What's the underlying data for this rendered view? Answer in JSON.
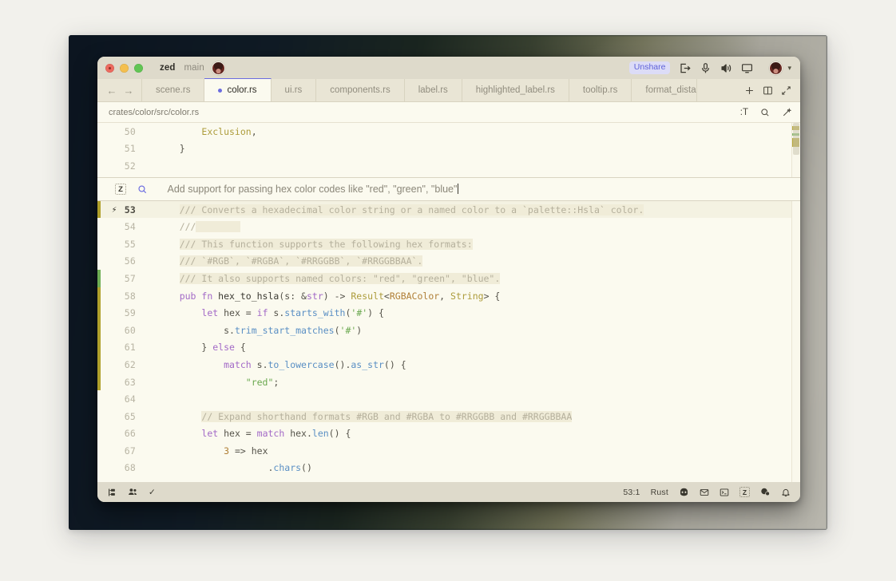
{
  "window": {
    "project": "zed",
    "branch": "main",
    "unshare_label": "Unshare"
  },
  "titlebar_icons": [
    {
      "name": "leave-call-icon"
    },
    {
      "name": "microphone-icon"
    },
    {
      "name": "speaker-icon"
    },
    {
      "name": "screen-share-icon"
    }
  ],
  "nav": {
    "back": "←",
    "forward": "→"
  },
  "tabs": [
    {
      "label": "scene.rs",
      "active": false
    },
    {
      "label": "color.rs",
      "active": true
    },
    {
      "label": "ui.rs",
      "active": false
    },
    {
      "label": "components.rs",
      "active": false
    },
    {
      "label": "label.rs",
      "active": false
    },
    {
      "label": "highlighted_label.rs",
      "active": false
    },
    {
      "label": "tooltip.rs",
      "active": false
    },
    {
      "label": "format_dista",
      "active": false
    }
  ],
  "tab_actions": [
    {
      "name": "new-tab-button",
      "glyph": "+"
    },
    {
      "name": "split-pane-button",
      "glyph": "split"
    },
    {
      "name": "zoom-pane-button",
      "glyph": "expand"
    }
  ],
  "breadcrumb": {
    "path": "crates/color/src/color.rs",
    "actions": [
      {
        "name": "toggle-inlay-hints-button",
        "label": ":T"
      },
      {
        "name": "buffer-search-button",
        "label": "search"
      },
      {
        "name": "selection-tools-button",
        "label": "wand"
      }
    ]
  },
  "assist": {
    "prompt": "Add support for passing hex color codes like \"red\", \"green\", \"blue\"",
    "zed_icon": "Z",
    "search_icon": "search-icon"
  },
  "editor": {
    "lines_above": [
      {
        "num": "50",
        "indent": 8,
        "segments": [
          {
            "t": "Exclusion",
            "c": "c-ty"
          },
          {
            "t": ",",
            "c": "c-punc"
          }
        ]
      },
      {
        "num": "51",
        "indent": 4,
        "segments": [
          {
            "t": "}",
            "c": "c-punc"
          }
        ]
      },
      {
        "num": "52",
        "indent": 0,
        "segments": []
      }
    ],
    "lines_below": [
      {
        "num": "53",
        "current": true,
        "bolt": "⚡",
        "git": "mod",
        "indent": 4,
        "segments": [
          {
            "t": "/// Converts a hexadecimal color string or a named color to a `palette::Hsla` color.",
            "c": "c-com hl"
          }
        ]
      },
      {
        "num": "54",
        "indent": 4,
        "segments": [
          {
            "t": "///",
            "c": "c-com"
          },
          {
            "t": "        ",
            "c": "hl"
          }
        ]
      },
      {
        "num": "55",
        "indent": 4,
        "segments": [
          {
            "t": "/// This function supports the following hex formats:",
            "c": "c-com hl"
          }
        ]
      },
      {
        "num": "56",
        "indent": 4,
        "segments": [
          {
            "t": "/// `#RGB`, `#RGBA`, `#RRGGBB`, `#RRGGBBAA`.",
            "c": "c-com hl"
          }
        ]
      },
      {
        "num": "57",
        "git": "add",
        "indent": 4,
        "segments": [
          {
            "t": "/// It also supports named colors: \"red\", \"green\", \"blue\".",
            "c": "c-com hl"
          }
        ]
      },
      {
        "num": "58",
        "git": "mod",
        "indent": 4,
        "segments": [
          {
            "t": "pub fn ",
            "c": "c-kw"
          },
          {
            "t": "hex_to_hsla",
            "c": "c-fn"
          },
          {
            "t": "(s: &",
            "c": "c-punc"
          },
          {
            "t": "str",
            "c": "c-kw"
          },
          {
            "t": ") -> ",
            "c": "c-punc"
          },
          {
            "t": "Result",
            "c": "c-ty"
          },
          {
            "t": "<",
            "c": "c-punc"
          },
          {
            "t": "RGBAColor",
            "c": "c-type2"
          },
          {
            "t": ", ",
            "c": "c-punc"
          },
          {
            "t": "String",
            "c": "c-ty"
          },
          {
            "t": "> {",
            "c": "c-punc"
          }
        ]
      },
      {
        "num": "59",
        "git": "mod",
        "indent": 8,
        "segments": [
          {
            "t": "let",
            "c": "c-kw"
          },
          {
            "t": " hex = ",
            "c": "c-punc"
          },
          {
            "t": "if",
            "c": "c-kw"
          },
          {
            "t": " s.",
            "c": "c-punc"
          },
          {
            "t": "starts_with",
            "c": "c-meth"
          },
          {
            "t": "(",
            "c": "c-punc"
          },
          {
            "t": "'#'",
            "c": "c-str"
          },
          {
            "t": ") {",
            "c": "c-punc"
          }
        ]
      },
      {
        "num": "60",
        "git": "mod",
        "indent": 12,
        "segments": [
          {
            "t": "s.",
            "c": "c-punc"
          },
          {
            "t": "trim_start_matches",
            "c": "c-meth"
          },
          {
            "t": "(",
            "c": "c-punc"
          },
          {
            "t": "'#'",
            "c": "c-str"
          },
          {
            "t": ")",
            "c": "c-punc"
          }
        ]
      },
      {
        "num": "61",
        "git": "mod",
        "indent": 8,
        "segments": [
          {
            "t": "} ",
            "c": "c-punc"
          },
          {
            "t": "else",
            "c": "c-kw"
          },
          {
            "t": " {",
            "c": "c-punc"
          }
        ]
      },
      {
        "num": "62",
        "git": "mod",
        "indent": 12,
        "segments": [
          {
            "t": "match",
            "c": "c-kw"
          },
          {
            "t": " s.",
            "c": "c-punc"
          },
          {
            "t": "to_lowercase",
            "c": "c-meth"
          },
          {
            "t": "().",
            "c": "c-punc"
          },
          {
            "t": "as_str",
            "c": "c-meth"
          },
          {
            "t": "() {",
            "c": "c-punc"
          }
        ]
      },
      {
        "num": "63",
        "git": "mod",
        "indent": 16,
        "segments": [
          {
            "t": "\"red\"",
            "c": "c-str"
          },
          {
            "t": ";",
            "c": "c-punc"
          }
        ]
      },
      {
        "num": "64",
        "indent": 0,
        "segments": []
      },
      {
        "num": "65",
        "indent": 8,
        "segments": [
          {
            "t": "// Expand shorthand formats #RGB and #RGBA to #RRGGBB and #RRGGBBAA",
            "c": "c-com hl"
          }
        ]
      },
      {
        "num": "66",
        "indent": 8,
        "segments": [
          {
            "t": "let",
            "c": "c-kw"
          },
          {
            "t": " hex = ",
            "c": "c-punc"
          },
          {
            "t": "match",
            "c": "c-kw"
          },
          {
            "t": " hex.",
            "c": "c-punc"
          },
          {
            "t": "len",
            "c": "c-meth"
          },
          {
            "t": "() {",
            "c": "c-punc"
          }
        ]
      },
      {
        "num": "67",
        "indent": 12,
        "segments": [
          {
            "t": "3",
            "c": "c-num"
          },
          {
            "t": " => hex",
            "c": "c-punc"
          }
        ]
      },
      {
        "num": "68",
        "indent": 20,
        "segments": [
          {
            "t": ".",
            "c": "c-punc"
          },
          {
            "t": "chars",
            "c": "c-meth"
          },
          {
            "t": "()",
            "c": "c-punc"
          }
        ]
      }
    ]
  },
  "statusbar": {
    "left_icons": [
      {
        "name": "project-panel-icon"
      },
      {
        "name": "collab-panel-icon"
      },
      {
        "name": "diagnostics-ok-icon",
        "glyph": "✓"
      }
    ],
    "cursor_position": "53:1",
    "language": "Rust",
    "right_icons": [
      {
        "name": "copilot-icon"
      },
      {
        "name": "inbox-icon"
      },
      {
        "name": "terminal-icon"
      },
      {
        "name": "assistant-panel-icon",
        "glyph": "Z"
      },
      {
        "name": "chat-panel-icon"
      },
      {
        "name": "notifications-icon"
      }
    ]
  },
  "theme": {
    "accent": "#6b6ce0",
    "background": "#fbfaef",
    "chrome": "#dedacb",
    "git_modified": "#b0a02c",
    "git_added": "#6fae55"
  }
}
